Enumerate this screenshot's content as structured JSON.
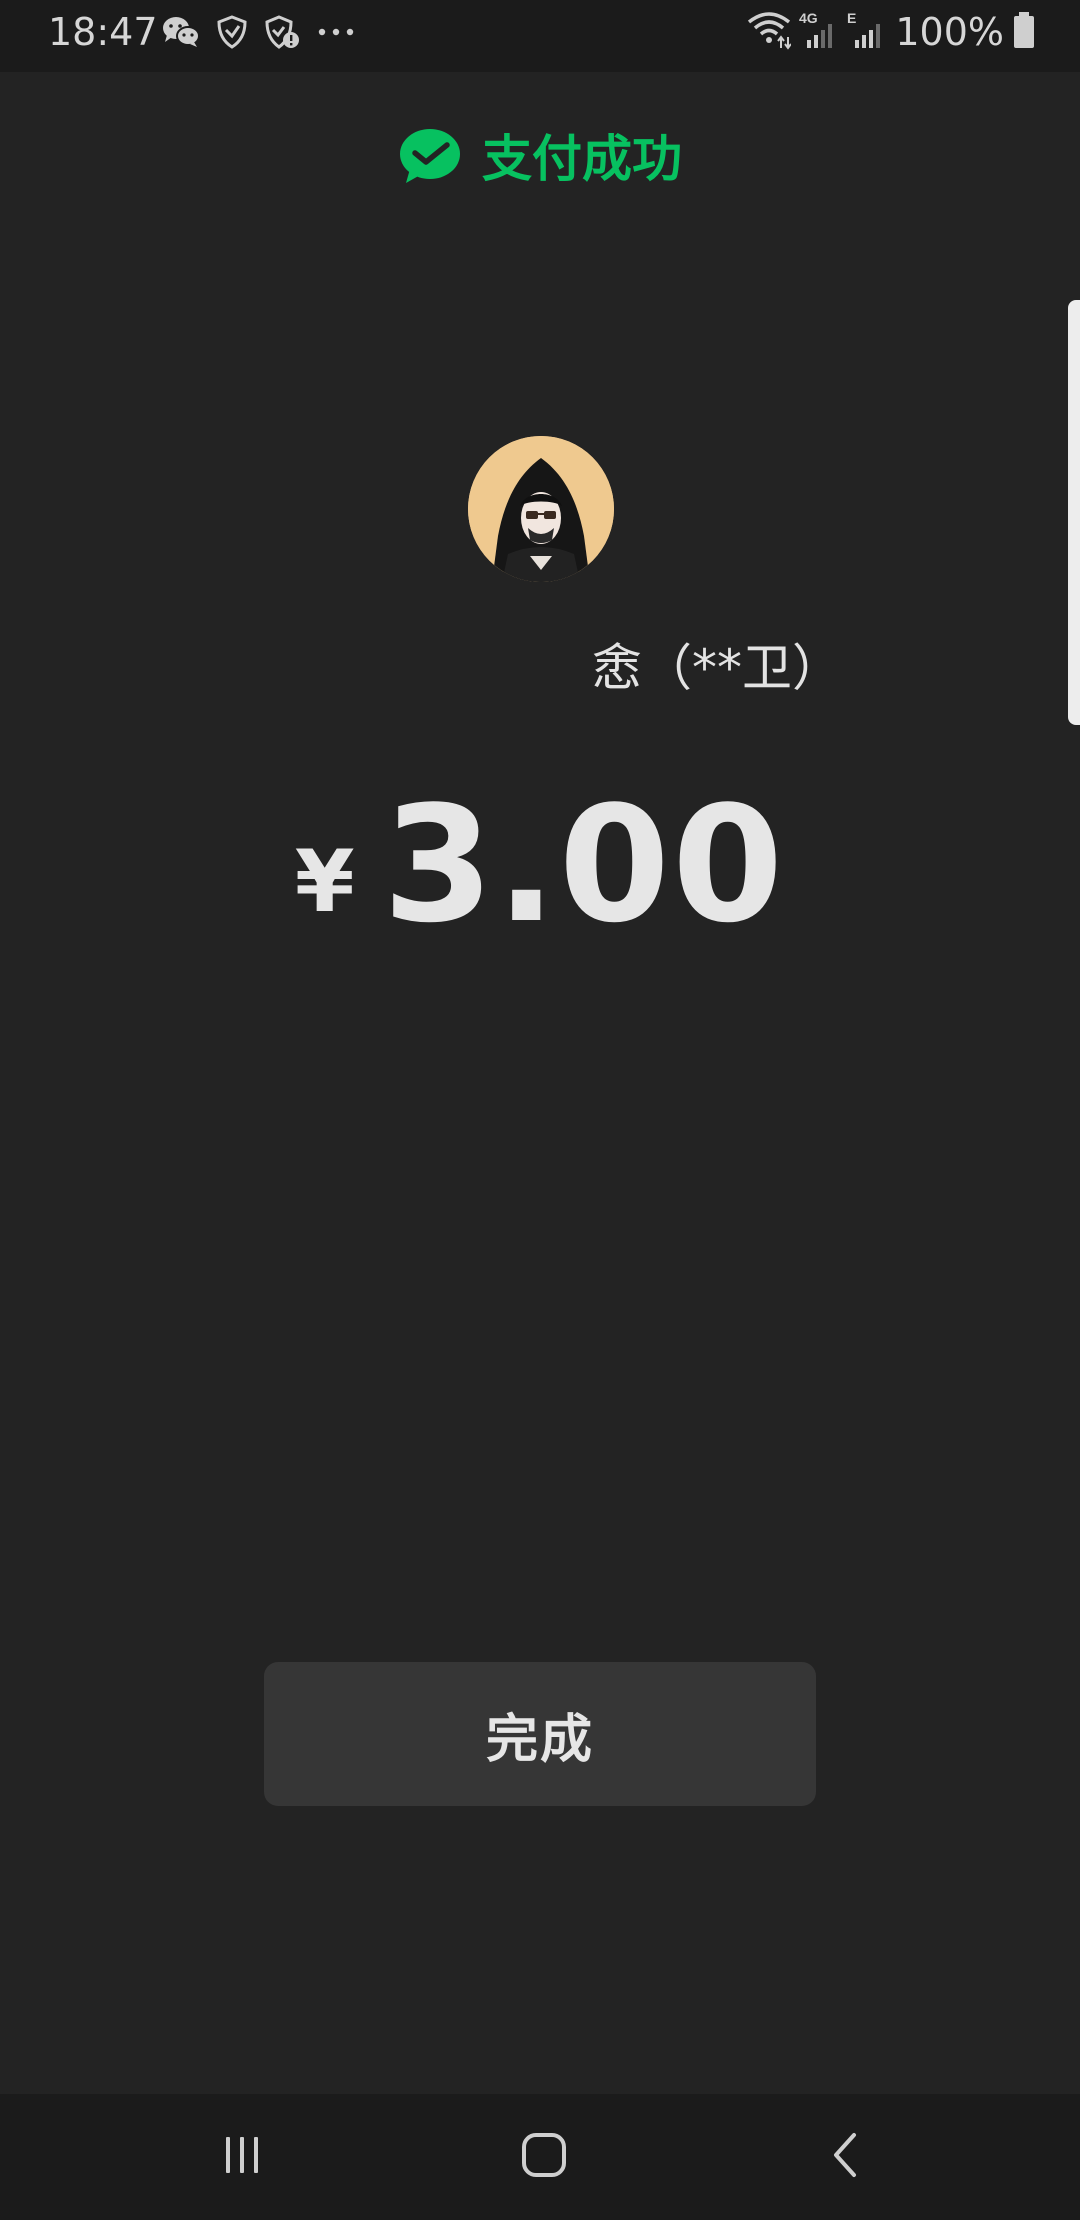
{
  "status_bar": {
    "time": "18:47",
    "left_icons": [
      "wechat-icon",
      "shield-check-icon",
      "shield-alert-icon",
      "more-dots-icon"
    ],
    "right_icons": [
      "wifi-icon",
      "signal-4g-icon",
      "signal-e-icon",
      "battery-icon"
    ],
    "network_4g": "4G",
    "network_e": "E",
    "battery_percent": "100%"
  },
  "header": {
    "icon": "check-bubble-icon",
    "title": "支付成功"
  },
  "payee": {
    "avatar": "avatar-hooded-figure",
    "name": "悆（**卫）"
  },
  "payment": {
    "currency_symbol": "¥",
    "amount": "3.00"
  },
  "actions": {
    "done_label": "完成"
  },
  "nav_bar": {
    "items": [
      "recent-apps-icon",
      "home-icon",
      "back-icon"
    ]
  },
  "colors": {
    "background": "#232323",
    "bars": "#1b1b1b",
    "accent_green": "#07c160",
    "button": "#363636",
    "text": "#e6e6e6"
  }
}
